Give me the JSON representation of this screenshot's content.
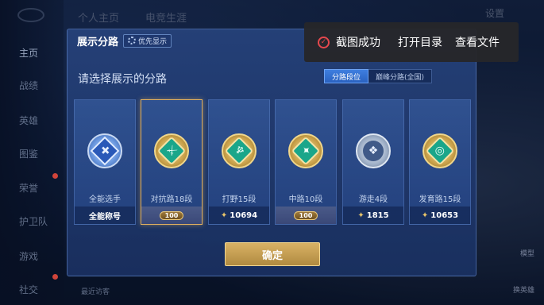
{
  "top_tabs": [
    "个人主页",
    "电竞生涯"
  ],
  "top_right": "设置",
  "sidebar": {
    "items": [
      {
        "label": "主页",
        "active": true
      },
      {
        "label": "战绩",
        "active": false
      },
      {
        "label": "英雄",
        "active": false
      },
      {
        "label": "图鉴",
        "active": false
      },
      {
        "label": "荣誉",
        "active": false
      },
      {
        "label": "护卫队",
        "active": false
      },
      {
        "label": "游戏",
        "active": false
      },
      {
        "label": "社交",
        "active": false
      }
    ]
  },
  "dialog": {
    "title": "展示分路",
    "priority_label": "优先显示",
    "prompt": "请选择展示的分路",
    "segment": {
      "on": "分路段位",
      "off": "巅峰分路(全国)"
    },
    "cards": [
      {
        "lane": "全能选手",
        "bottom": "全能称号",
        "emblem": "blue",
        "icon": "all-round-icon",
        "glyph": "✚",
        "selected": false,
        "bottom_type": "title"
      },
      {
        "lane": "对抗路18段",
        "bottom": "100",
        "emblem": "gold",
        "icon": "clash-lane-icon",
        "glyph": "⚔",
        "selected": true,
        "bottom_type": "badge"
      },
      {
        "lane": "打野15段",
        "bottom": "10694",
        "emblem": "gold",
        "icon": "jungle-icon",
        "glyph": "♆",
        "selected": false,
        "bottom_type": "score"
      },
      {
        "lane": "中路10段",
        "bottom": "100",
        "emblem": "gold",
        "icon": "mid-lane-icon",
        "glyph": "✦",
        "selected": false,
        "bottom_type": "badge"
      },
      {
        "lane": "游走4段",
        "bottom": "1815",
        "emblem": "silver",
        "icon": "roam-icon",
        "glyph": "❖",
        "selected": false,
        "bottom_type": "score"
      },
      {
        "lane": "发育路15段",
        "bottom": "10653",
        "emblem": "gold",
        "icon": "farm-lane-icon",
        "glyph": "◎",
        "selected": false,
        "bottom_type": "score"
      }
    ],
    "confirm_label": "确定"
  },
  "toast": {
    "message": "截图成功",
    "open_dir": "打开目录",
    "view_file": "查看文件"
  },
  "right_hints": [
    "模型",
    "换英雄"
  ],
  "bottom_hint": "最近访客"
}
